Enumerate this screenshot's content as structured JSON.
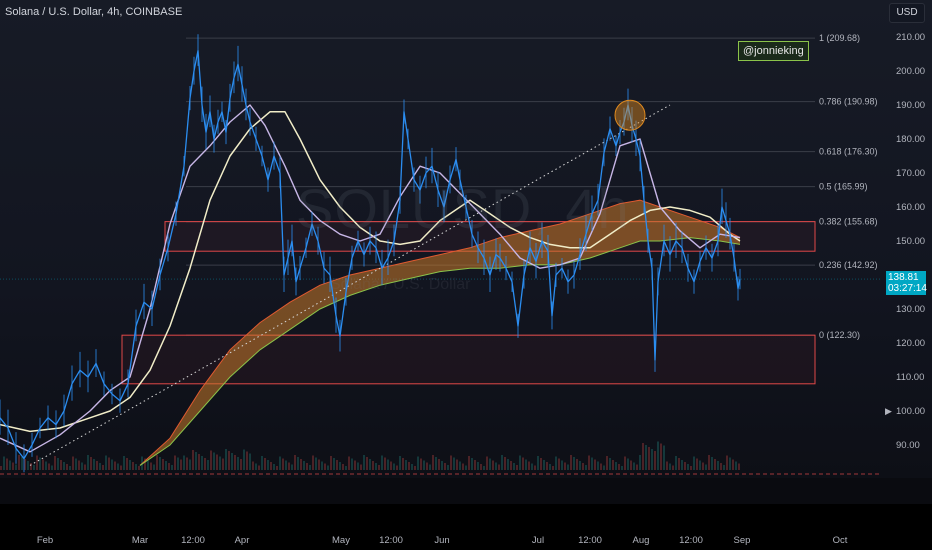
{
  "header": {
    "symbol_line": "Solana / U.S. Dollar, 4h, COINBASE",
    "currency": "USD",
    "watermark_tag": "@jonnieking",
    "bg_watermark": "SOLUSD, 4h",
    "bg_watermark_sub": "Solana / U.S. Dollar"
  },
  "price_tag": {
    "price": "138.81",
    "countdown": "03:27:14"
  },
  "scroll_arrow": "▶",
  "colors": {
    "background": "#131722",
    "price_line": "#2b8df0",
    "ma_white": "#f1edc8",
    "ma_lilac": "#c7b6e6",
    "ribbon_fill": "#c87a2a",
    "ribbon_edge": "#8bc34a",
    "fib_line": "#3a3e48",
    "zone_border": "#e04848",
    "trendline": "#d8d8d8",
    "circle": "#e08a1e",
    "accent": "#00a7c4"
  },
  "chart_data": {
    "type": "line",
    "title": "Solana / U.S. Dollar, 4h, COINBASE",
    "xlabel": "",
    "ylabel": "",
    "ylim": [
      84,
      212
    ],
    "y_ticks": [
      "210.00",
      "200.00",
      "190.00",
      "180.00",
      "170.00",
      "160.00",
      "150.00",
      "140.00",
      "130.00",
      "120.00",
      "110.00",
      "100.00",
      "90.00"
    ],
    "x_labels": [
      "Feb",
      "Mar",
      "12:00",
      "Apr",
      "May",
      "12:00",
      "Jun",
      "Jul",
      "12:00",
      "Aug",
      "12:00",
      "Sep",
      "Oct"
    ],
    "last_price": 138.81,
    "fib_levels": [
      {
        "label": "1 (209.68)",
        "value": 209.68
      },
      {
        "label": "0.786 (190.98)",
        "value": 190.98
      },
      {
        "label": "0.618 (176.30)",
        "value": 176.3
      },
      {
        "label": "0.5 (165.99)",
        "value": 165.99
      },
      {
        "label": "0.382 (155.68)",
        "value": 155.68
      },
      {
        "label": "0.236 (142.92)",
        "value": 142.92
      },
      {
        "label": "0 (122.30)",
        "value": 122.3
      }
    ],
    "zones": [
      {
        "from": 147,
        "to": 155.7
      },
      {
        "from": 108,
        "to": 122.3
      }
    ],
    "series": [
      {
        "values": [
          [
            0,
            98
          ],
          [
            8,
            95
          ],
          [
            16,
            89
          ],
          [
            24,
            86
          ],
          [
            32,
            90
          ],
          [
            40,
            95
          ],
          [
            48,
            98
          ],
          [
            56,
            96
          ],
          [
            64,
            100
          ],
          [
            72,
            108
          ],
          [
            80,
            112
          ],
          [
            88,
            110
          ],
          [
            96,
            114
          ],
          [
            104,
            108
          ],
          [
            112,
            105
          ],
          [
            120,
            103
          ],
          [
            128,
            108
          ],
          [
            136,
            125
          ],
          [
            144,
            132
          ],
          [
            152,
            130
          ],
          [
            160,
            140
          ],
          [
            168,
            148
          ],
          [
            176,
            158
          ],
          [
            184,
            172
          ],
          [
            190,
            192
          ],
          [
            194,
            200
          ],
          [
            198,
            206
          ],
          [
            202,
            190
          ],
          [
            206,
            182
          ],
          [
            210,
            188
          ],
          [
            214,
            180
          ],
          [
            218,
            185
          ],
          [
            222,
            188
          ],
          [
            226,
            182
          ],
          [
            230,
            192
          ],
          [
            234,
            198
          ],
          [
            238,
            202
          ],
          [
            242,
            196
          ],
          [
            246,
            190
          ],
          [
            250,
            185
          ],
          [
            256,
            180
          ],
          [
            262,
            175
          ],
          [
            268,
            168
          ],
          [
            274,
            175
          ],
          [
            280,
            170
          ],
          [
            284,
            140
          ],
          [
            288,
            145
          ],
          [
            292,
            150
          ],
          [
            296,
            138
          ],
          [
            300,
            142
          ],
          [
            306,
            148
          ],
          [
            312,
            155
          ],
          [
            318,
            150
          ],
          [
            324,
            142
          ],
          [
            330,
            140
          ],
          [
            336,
            128
          ],
          [
            340,
            122
          ],
          [
            346,
            135
          ],
          [
            352,
            145
          ],
          [
            358,
            150
          ],
          [
            364,
            146
          ],
          [
            370,
            150
          ],
          [
            376,
            148
          ],
          [
            382,
            142
          ],
          [
            388,
            145
          ],
          [
            394,
            150
          ],
          [
            400,
            162
          ],
          [
            404,
            188
          ],
          [
            408,
            180
          ],
          [
            414,
            168
          ],
          [
            420,
            165
          ],
          [
            426,
            170
          ],
          [
            432,
            172
          ],
          [
            438,
            165
          ],
          [
            444,
            160
          ],
          [
            450,
            168
          ],
          [
            456,
            174
          ],
          [
            460,
            168
          ],
          [
            466,
            160
          ],
          [
            472,
            152
          ],
          [
            478,
            148
          ],
          [
            484,
            145
          ],
          [
            490,
            140
          ],
          [
            496,
            146
          ],
          [
            500,
            145
          ],
          [
            506,
            142
          ],
          [
            512,
            138
          ],
          [
            518,
            125
          ],
          [
            524,
            140
          ],
          [
            530,
            148
          ],
          [
            536,
            144
          ],
          [
            542,
            150
          ],
          [
            548,
            147
          ],
          [
            552,
            128
          ],
          [
            556,
            140
          ],
          [
            562,
            142
          ],
          [
            568,
            138
          ],
          [
            574,
            140
          ],
          [
            580,
            146
          ],
          [
            586,
            152
          ],
          [
            592,
            158
          ],
          [
            598,
            162
          ],
          [
            604,
            176
          ],
          [
            610,
            183
          ],
          [
            616,
            178
          ],
          [
            620,
            182
          ],
          [
            624,
            185
          ],
          [
            628,
            190
          ],
          [
            632,
            184
          ],
          [
            636,
            180
          ],
          [
            640,
            175
          ],
          [
            644,
            162
          ],
          [
            648,
            150
          ],
          [
            652,
            142
          ],
          [
            655,
            115
          ],
          [
            658,
            138
          ],
          [
            664,
            150
          ],
          [
            670,
            146
          ],
          [
            676,
            150
          ],
          [
            682,
            148
          ],
          [
            688,
            142
          ],
          [
            694,
            138
          ],
          [
            700,
            144
          ],
          [
            706,
            148
          ],
          [
            712,
            145
          ],
          [
            718,
            150
          ],
          [
            722,
            160
          ],
          [
            726,
            156
          ],
          [
            730,
            152
          ],
          [
            734,
            145
          ],
          [
            738,
            136
          ],
          [
            740,
            138.81
          ]
        ]
      },
      {
        "values": [
          [
            0,
            96
          ],
          [
            30,
            94
          ],
          [
            60,
            95
          ],
          [
            90,
            98
          ],
          [
            110,
            100
          ],
          [
            130,
            104
          ],
          [
            150,
            112
          ],
          [
            170,
            125
          ],
          [
            190,
            142
          ],
          [
            210,
            162
          ],
          [
            230,
            175
          ],
          [
            250,
            183
          ],
          [
            270,
            188
          ],
          [
            285,
            188
          ],
          [
            300,
            180
          ],
          [
            320,
            168
          ],
          [
            340,
            160
          ],
          [
            360,
            154
          ],
          [
            380,
            150
          ],
          [
            400,
            149
          ],
          [
            420,
            150
          ],
          [
            440,
            156
          ],
          [
            460,
            160
          ],
          [
            470,
            162
          ],
          [
            490,
            158
          ],
          [
            510,
            154
          ],
          [
            530,
            151
          ],
          [
            550,
            149
          ],
          [
            570,
            148
          ],
          [
            590,
            148
          ],
          [
            610,
            152
          ],
          [
            630,
            156
          ],
          [
            650,
            159
          ],
          [
            670,
            160
          ],
          [
            690,
            159
          ],
          [
            710,
            157
          ],
          [
            730,
            152
          ],
          [
            740,
            150
          ]
        ]
      },
      {
        "values": [
          [
            0,
            92
          ],
          [
            30,
            88
          ],
          [
            60,
            93
          ],
          [
            90,
            100
          ],
          [
            110,
            106
          ],
          [
            130,
            110
          ],
          [
            150,
            130
          ],
          [
            170,
            155
          ],
          [
            190,
            172
          ],
          [
            210,
            178
          ],
          [
            230,
            185
          ],
          [
            250,
            190
          ],
          [
            265,
            184
          ],
          [
            285,
            172
          ],
          [
            300,
            162
          ],
          [
            320,
            156
          ],
          [
            340,
            152
          ],
          [
            360,
            150
          ],
          [
            380,
            152
          ],
          [
            400,
            163
          ],
          [
            420,
            172
          ],
          [
            440,
            170
          ],
          [
            460,
            164
          ],
          [
            480,
            158
          ],
          [
            500,
            152
          ],
          [
            520,
            145
          ],
          [
            540,
            142
          ],
          [
            560,
            143
          ],
          [
            580,
            145
          ],
          [
            600,
            158
          ],
          [
            620,
            178
          ],
          [
            640,
            180
          ],
          [
            650,
            170
          ],
          [
            660,
            160
          ],
          [
            680,
            153
          ],
          [
            700,
            148
          ],
          [
            720,
            152
          ],
          [
            740,
            151
          ]
        ]
      },
      {
        "name": "",
        "values_top": [
          [
            140,
            84
          ],
          [
            170,
            92
          ],
          [
            200,
            106
          ],
          [
            230,
            118
          ],
          [
            260,
            126
          ],
          [
            290,
            132
          ],
          [
            320,
            137
          ],
          [
            350,
            140
          ],
          [
            380,
            142
          ],
          [
            410,
            144
          ],
          [
            440,
            146
          ],
          [
            470,
            148
          ],
          [
            500,
            151
          ],
          [
            530,
            153
          ],
          [
            560,
            155
          ],
          [
            590,
            158
          ],
          [
            620,
            161
          ],
          [
            640,
            162
          ],
          [
            660,
            160
          ],
          [
            690,
            157
          ],
          [
            720,
            154
          ],
          [
            740,
            151
          ]
        ],
        "values_bottom": [
          [
            140,
            84
          ],
          [
            170,
            90
          ],
          [
            200,
            100
          ],
          [
            230,
            110
          ],
          [
            260,
            118
          ],
          [
            290,
            124
          ],
          [
            320,
            130
          ],
          [
            350,
            134
          ],
          [
            380,
            137
          ],
          [
            410,
            139
          ],
          [
            440,
            141
          ],
          [
            470,
            142
          ],
          [
            500,
            142
          ],
          [
            530,
            143
          ],
          [
            560,
            143
          ],
          [
            590,
            145
          ],
          [
            620,
            148
          ],
          [
            640,
            150
          ],
          [
            660,
            150
          ],
          [
            690,
            151
          ],
          [
            720,
            150
          ],
          [
            740,
            149
          ]
        ]
      }
    ],
    "trendline": {
      "from": [
        30,
        84
      ],
      "to": [
        670,
        190
      ]
    },
    "highlight_circle": {
      "x": 630,
      "value": 187
    }
  }
}
